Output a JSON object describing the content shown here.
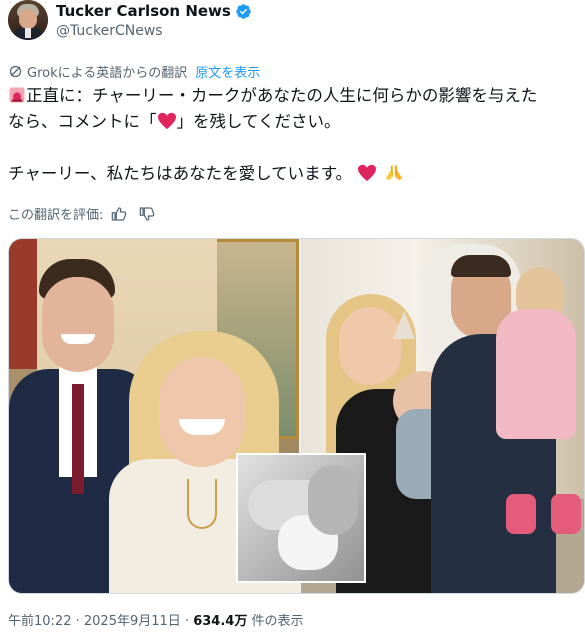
{
  "author": {
    "display_name": "Tucker Carlson News",
    "handle": "@TuckerCNews",
    "verified_color": "#1d9bf0"
  },
  "translation": {
    "note": "Grokによる英語からの翻訳",
    "show_original": "原文を表示"
  },
  "tweet": {
    "line1": "正直に：チャーリー・カークがあなたの人生に何らかの影響を与えた",
    "line2a": "なら、コメントに「",
    "line2b": "」を残してください。",
    "line3": "チャーリー、私たちはあなたを愛しています。",
    "emojis": [
      "siren-icon",
      "red-heart-icon",
      "red-heart-icon",
      "folded-hands-icon"
    ]
  },
  "rate": {
    "label": "この翻訳を評価:"
  },
  "meta": {
    "time": "午前10:22",
    "date": "2025年9月11日",
    "views_count": "634.4万",
    "views_label": "件の表示",
    "separator": "·"
  },
  "colors": {
    "accent": "#1d9bf0",
    "secondary_text": "#536471",
    "heart": "#f91880"
  }
}
